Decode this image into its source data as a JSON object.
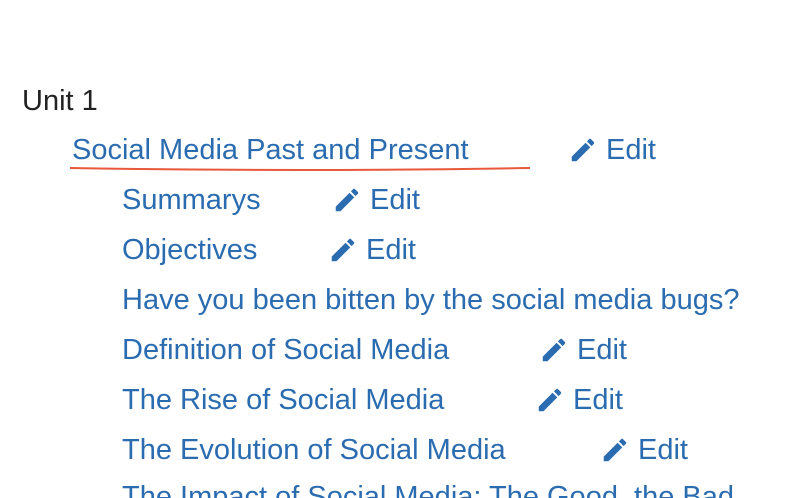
{
  "unit": {
    "title": "Unit 1"
  },
  "section": {
    "title": "Social Media Past and Present",
    "edit_label": "Edit"
  },
  "items": [
    {
      "label": "Summarys",
      "edit_label": "Edit"
    },
    {
      "label": "Objectives",
      "edit_label": "Edit"
    },
    {
      "label": "Have you been bitten by the social media bugs?"
    },
    {
      "label": "Definition of Social Media",
      "edit_label": "Edit"
    },
    {
      "label": "The Rise of Social Media",
      "edit_label": "Edit"
    },
    {
      "label": "The Evolution of Social Media",
      "edit_label": "Edit"
    },
    {
      "label": "The Impact of Social Media: The Good, the Bad"
    }
  ],
  "colors": {
    "link": "#2b6cb0",
    "text": "#222222",
    "underline": "#e8593c"
  }
}
